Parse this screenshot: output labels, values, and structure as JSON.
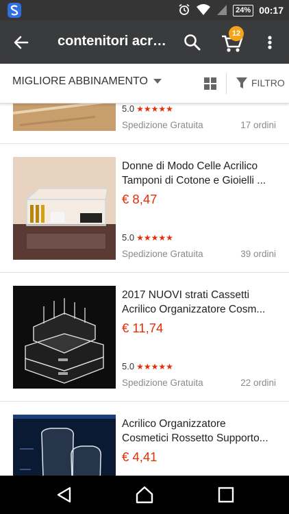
{
  "status_bar": {
    "battery": "24%",
    "time": "00:17"
  },
  "app_bar": {
    "title": "contenitori acrilici",
    "cart_count": "12"
  },
  "sort_bar": {
    "sort_label": "MIGLIORE ABBINAMENTO",
    "filter_label": "FILTRO"
  },
  "products": [
    {
      "title_line1": "",
      "title_line2": "",
      "price": "",
      "rating": "5.0",
      "stars": "★★★★★",
      "shipping": "Spedizione Gratuita",
      "orders": "17 ordini"
    },
    {
      "title_line1": "Donne di Modo Celle Acrilico",
      "title_line2": "Tamponi di Cotone e Gioielli ...",
      "price": "€ 8,47",
      "rating": "5.0",
      "stars": "★★★★★",
      "shipping": "Spedizione Gratuita",
      "orders": "39 ordini"
    },
    {
      "title_line1": "2017 NUOVI strati Cassetti",
      "title_line2": "Acrilico Organizzatore Cosm...",
      "price": "€ 11,74",
      "rating": "5.0",
      "stars": "★★★★★",
      "shipping": "Spedizione Gratuita",
      "orders": "22 ordini"
    },
    {
      "title_line1": "Acrilico Organizzatore",
      "title_line2": "Cosmetici Rossetto Supporto...",
      "price": "€ 4,41",
      "rating": "",
      "stars": "",
      "shipping": "",
      "orders": ""
    }
  ],
  "colors": {
    "price_red": "#e62e04",
    "cart_badge": "#f5a31a",
    "app_bar": "#3a3b3d"
  },
  "icons": {
    "back": "arrow-left-icon",
    "search": "search-icon",
    "cart": "cart-icon",
    "more": "more-vert-icon",
    "grid": "grid-view-icon",
    "filter": "filter-icon"
  }
}
